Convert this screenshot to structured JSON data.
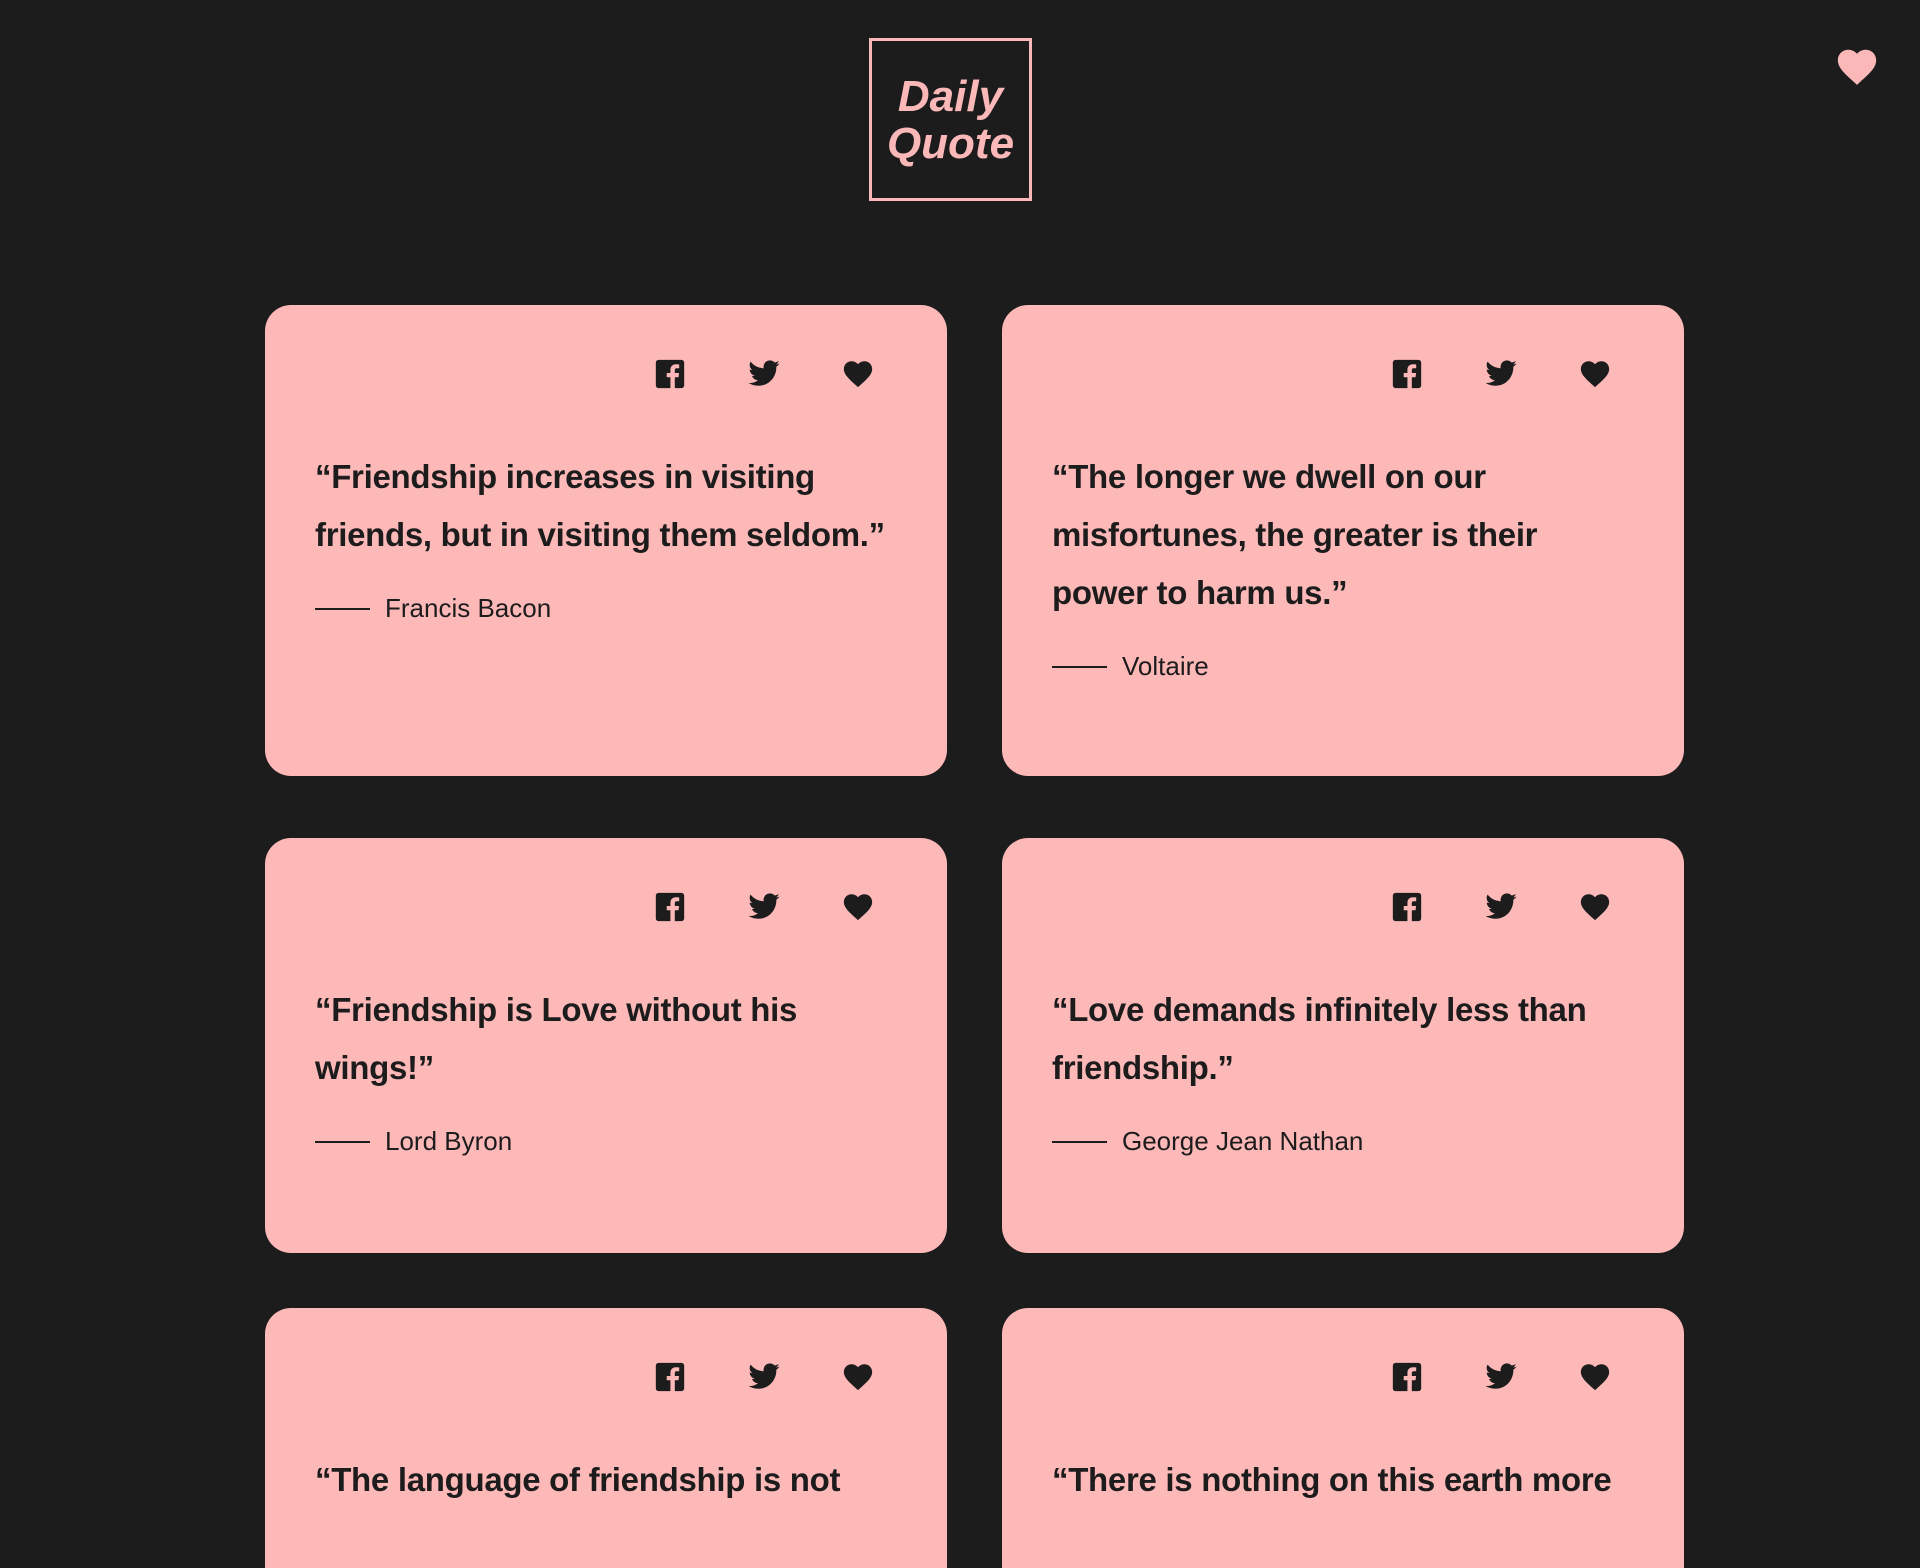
{
  "header": {
    "logo_line1": "Daily",
    "logo_line2": "Quote",
    "favorites_icon": "heart-icon"
  },
  "colors": {
    "background": "#1d1c1d",
    "card": "#fdb8b8",
    "accent": "#fbb8b8",
    "text": "#1d1c1d"
  },
  "cards": [
    {
      "quote": "“Friendship increases in visiting friends, but in visiting them seldom.”",
      "author": "Francis Bacon",
      "icons": [
        "facebook-icon",
        "twitter-icon",
        "heart-icon"
      ]
    },
    {
      "quote": "“The longer we dwell on our misfortunes, the greater is their power to harm us.”",
      "author": "Voltaire",
      "icons": [
        "facebook-icon",
        "twitter-icon",
        "heart-icon"
      ]
    },
    {
      "quote": "“Friendship is Love without his wings!”",
      "author": "Lord Byron",
      "icons": [
        "facebook-icon",
        "twitter-icon",
        "heart-icon"
      ]
    },
    {
      "quote": "“Love demands infinitely less than friendship.”",
      "author": "George Jean Nathan",
      "icons": [
        "facebook-icon",
        "twitter-icon",
        "heart-icon"
      ]
    },
    {
      "quote": "“The language of friendship is not",
      "author": "",
      "icons": [
        "facebook-icon",
        "twitter-icon",
        "heart-icon"
      ]
    },
    {
      "quote": "“There is nothing on this earth more",
      "author": "",
      "icons": [
        "facebook-icon",
        "twitter-icon",
        "heart-icon"
      ]
    }
  ]
}
